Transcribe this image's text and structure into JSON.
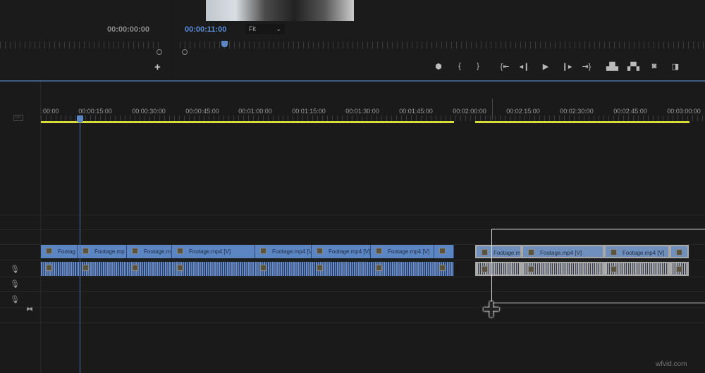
{
  "source_monitor": {
    "timecode": "00:00:00:00",
    "add_icon": "plus-icon"
  },
  "program_monitor": {
    "timecode": "00:00:11:00",
    "zoom_select": "Fit",
    "timecode_color": "#5b8fd6"
  },
  "transport": [
    "marker-icon",
    "mark-in-icon",
    "mark-out-icon",
    "go-to-in-icon",
    "step-back-icon",
    "play-icon",
    "step-forward-icon",
    "go-to-out-icon",
    "lift-icon",
    "extract-icon",
    "export-frame-icon",
    "comparison-view-icon"
  ],
  "timeline": {
    "ruler_labels": [
      ":00:00",
      "00:00:15:00",
      "00:00:30:00",
      "00:00:45:00",
      "00:01:00:00",
      "00:01:15:00",
      "00:01:30:00",
      "00:01:45:00",
      "00:02:00:00",
      "00:02:15:00",
      "00:02:30:00",
      "00:02:45:00",
      "00:03:00:00"
    ],
    "work_area_color": "#d8dd3a",
    "playhead_color": "#5b86c3",
    "video_clips": [
      {
        "label": "Footag",
        "selected": false
      },
      {
        "label": "Footage.mp",
        "selected": false
      },
      {
        "label": "Footage.m",
        "selected": false
      },
      {
        "label": "Footage.mp4 [V]",
        "selected": false
      },
      {
        "label": "Footage.mp4 [V]",
        "selected": false
      },
      {
        "label": "Footage.mp4 [V]",
        "selected": false
      },
      {
        "label": "Footage.mp4 [V]",
        "selected": false
      },
      {
        "label": "",
        "selected": false
      },
      {
        "label": "Footage.m",
        "selected": true
      },
      {
        "label": "Footage.mp4 [V]",
        "selected": true
      },
      {
        "label": "Footage.mp4 [V]",
        "selected": true
      },
      {
        "label": "",
        "selected": true
      }
    ],
    "track_icons": [
      "microphone-icon",
      "microphone-icon",
      "microphone-icon"
    ],
    "cc_label": "CC"
  },
  "watermark": "wfvid.com"
}
